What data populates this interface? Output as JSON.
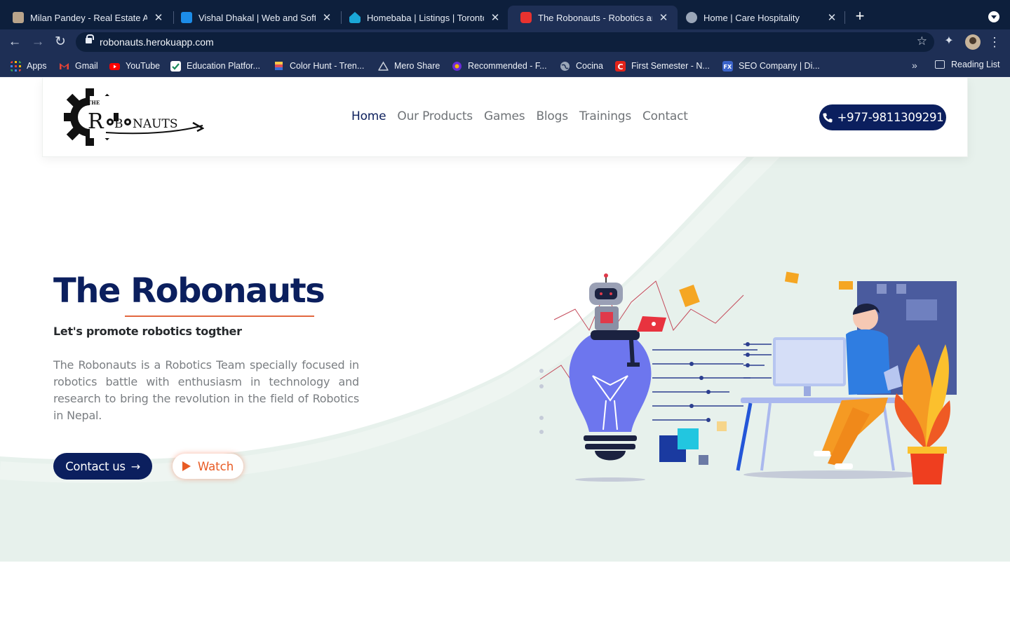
{
  "browser": {
    "tabs": [
      {
        "title": "Milan Pandey - Real Estate Age",
        "favicon_color": "#b9a48b"
      },
      {
        "title": "Vishal Dhakal | Web and Softw",
        "favicon_color": "#1c8ce8"
      },
      {
        "title": "Homebaba | Listings | Toronto",
        "favicon_color": "#1aa7d8"
      },
      {
        "title": "The Robonauts - Robotics and",
        "favicon_color": "#e8322f"
      },
      {
        "title": "Home | Care Hospitality",
        "favicon_color": "#9aa6b8"
      }
    ],
    "url": "robonauts.herokuapp.com",
    "bookmarks": [
      {
        "label": "Apps",
        "icon": "apps-grid-icon"
      },
      {
        "label": "Gmail",
        "icon": "gmail-icon"
      },
      {
        "label": "YouTube",
        "icon": "youtube-icon"
      },
      {
        "label": "Education Platfor...",
        "icon": "education-icon"
      },
      {
        "label": "Color Hunt - Tren...",
        "icon": "colorhunt-icon"
      },
      {
        "label": "Mero Share",
        "icon": "meroshare-icon"
      },
      {
        "label": "Recommended - F...",
        "icon": "recommended-icon"
      },
      {
        "label": "Cocina",
        "icon": "globe-icon"
      },
      {
        "label": "First Semester - N...",
        "icon": "c-icon"
      },
      {
        "label": "SEO Company | Di...",
        "icon": "fx-icon"
      }
    ],
    "reading_list": "Reading List"
  },
  "site": {
    "logo_text": "ROBONAUTS",
    "logo_small": "THE",
    "nav": [
      "Home",
      "Our Products",
      "Games",
      "Blogs",
      "Trainings",
      "Contact"
    ],
    "phone": "+977-9811309291"
  },
  "hero": {
    "title": "The Robonauts",
    "tagline": "Let's promote robotics togther",
    "description": "The Robonauts is a Robotics Team specially focused in robotics battle with enthusiasm in technology and research to bring the revolution in the field of Robotics in Nepal.",
    "contact_label": "Contact us",
    "watch_label": "Watch"
  },
  "colors": {
    "brand_navy": "#0b1f5e",
    "accent_orange": "#e85b24",
    "hero_mint": "#e7f1ec",
    "chrome_dark": "#0d1f3c",
    "chrome_toolbar": "#1e2f55"
  }
}
